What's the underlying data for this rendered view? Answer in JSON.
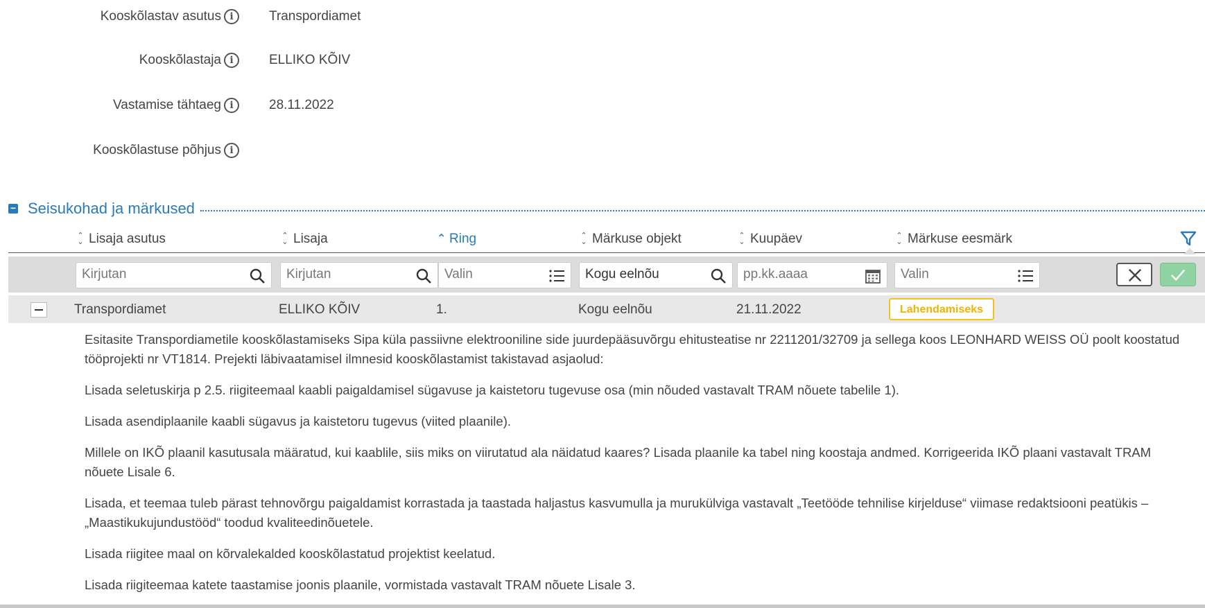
{
  "details": [
    {
      "label": "Kooskõlastav asutus",
      "value": "Transpordiamet"
    },
    {
      "label": "Kooskõlastaja",
      "value": "ELLIKO KÕIV"
    },
    {
      "label": "Vastamise tähtaeg",
      "value": "28.11.2022"
    },
    {
      "label": "Kooskõlastuse põhjus",
      "value": ""
    }
  ],
  "section": {
    "title": "Seisukohad ja märkused"
  },
  "columns": [
    "Lisaja asutus",
    "Lisaja",
    "Ring",
    "Märkuse objekt",
    "Kuupäev",
    "Märkuse eesmärk"
  ],
  "filters": {
    "asutus_placeholder": "Kirjutan",
    "lisaja_placeholder": "Kirjutan",
    "ring_placeholder": "Valin",
    "objekt_value": "Kogu eelnõu",
    "kuupaev_placeholder": "pp.kk.aaaa",
    "eesmark_placeholder": "Valin"
  },
  "row": {
    "asutus": "Transpordiamet",
    "lisaja": "ELLIKO KÕIV",
    "ring": "1.",
    "objekt": "Kogu eelnõu",
    "kuupaev": "21.11.2022",
    "eesmark": "Lahendamiseks"
  },
  "comment": [
    "Esitasite Transpordiametile kooskõlastamiseks Sipa küla passiivne elektrooniline side juurdepääsuvõrgu ehitusteatise nr 2211201/32709 ja sellega koos LEONHARD WEISS OÜ poolt koostatud tööprojekti nr VT1814. Prejekti läbivaatamisel ilmnesid kooskõlastamist takistavad asjaolud:",
    "Lisada seletuskirja p 2.5. riigiteemaal kaabli paigaldamisel sügavuse ja kaistetoru tugevuse osa (min nõuded vastavalt TRAM nõuete tabelile 1).",
    "Lisada asendiplaanile kaabli sügavus ja kaistetoru tugevus (viited plaanile).",
    "Millele on IKÕ plaanil kasutusala määratud, kui kaablile, siis miks on viirutatud ala näidatud kaares?  Lisada plaanile ka tabel ning koostaja andmed. Korrigeerida IKÕ plaani vastavalt TRAM nõuete Lisale 6.",
    "Lisada, et teemaa tuleb pärast tehnovõrgu paigaldamist korrastada ja taastada haljastus kasvumulla ja murukülviga vastavalt „Teetööde tehnilise kirjelduse“ viimase redaktsiooni peatükis – „Maastikukujundustööd“ toodud kvaliteedinõuetele.",
    "Lisada riigitee maal on kõrvalekalded kooskõlastatud projektist keelatud.",
    "Lisada riigiteemaa katete taastamise joonis plaanile, vormistada vastavalt TRAM nõuete Lisale 3."
  ],
  "colors": {
    "accent": "#2a7ab8",
    "badge": "#f2c31a",
    "ok": "#8fd3a2"
  }
}
